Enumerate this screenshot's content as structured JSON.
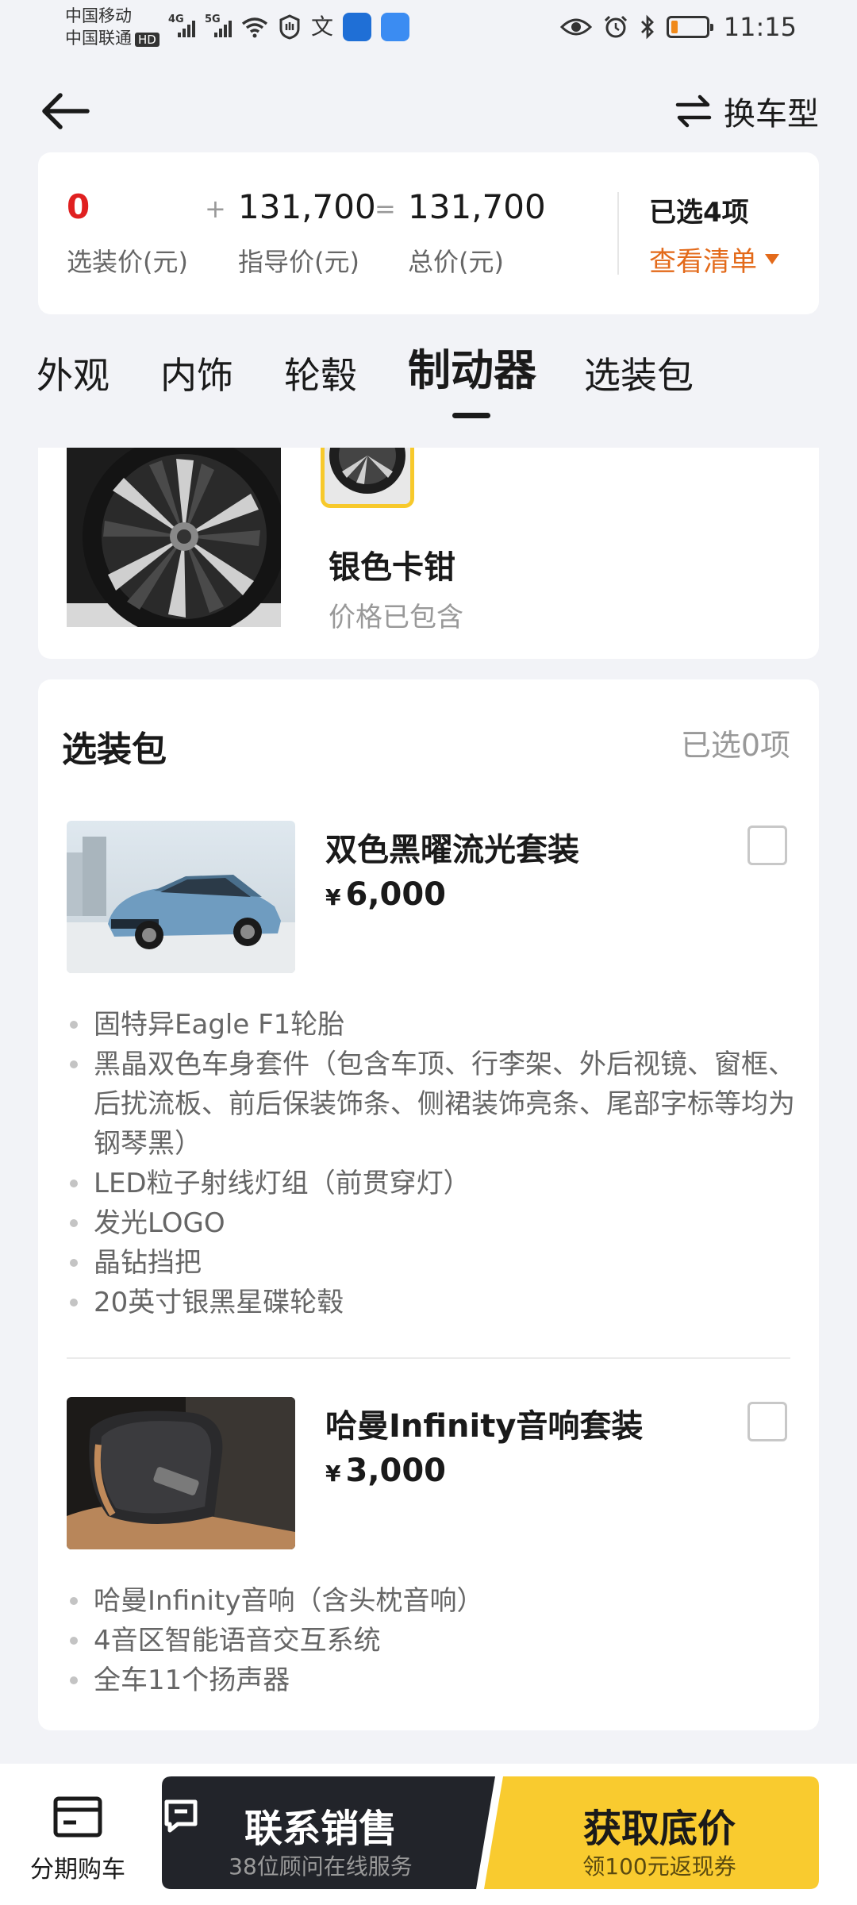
{
  "status_bar": {
    "carrier_1": "中国移动",
    "carrier_2": "中国联通",
    "hd_badge": "HD",
    "net_1": "4G",
    "net_2": "5G",
    "time": "11:15",
    "battery_level": 0.2
  },
  "header": {
    "change_model_label": "换车型"
  },
  "price_summary": {
    "option_price": "0",
    "option_price_label": "选装价(元)",
    "plus": "+",
    "guide_price": "131,700",
    "guide_price_label": "指导价(元)",
    "equals": "=",
    "total_price": "131,700",
    "total_price_label": "总价(元)",
    "selected_count": "已选4项",
    "view_list": "查看清单"
  },
  "tabs": [
    {
      "label": "外观"
    },
    {
      "label": "内饰"
    },
    {
      "label": "轮毂"
    },
    {
      "label": "制动器",
      "active": true
    },
    {
      "label": "选装包"
    }
  ],
  "brake": {
    "name": "银色卡钳",
    "note": "价格已包含"
  },
  "packages": {
    "title": "选装包",
    "selected_count": "已选0项",
    "items": [
      {
        "name": "双色黑曜流光套装",
        "currency": "¥",
        "price": "6,000",
        "features": [
          "固特异Eagle F1轮胎",
          "黑晶双色车身套件（包含车顶、行李架、外后视镜、窗框、后扰流板、前后保装饰条、侧裙装饰亮条、尾部字标等均为钢琴黑）",
          "LED粒子射线灯组（前贯穿灯）",
          "发光LOGO",
          "晶钻挡把",
          "20英寸银黑星碟轮毂"
        ]
      },
      {
        "name": "哈曼Infinity音响套装",
        "currency": "¥",
        "price": "3,000",
        "features": [
          "哈曼Infinity音响（含头枕音响）",
          "4音区智能语音交互系统",
          "全车11个扬声器"
        ]
      }
    ]
  },
  "bottom_bar": {
    "installment_label": "分期购车",
    "contact_main": "联系销售",
    "contact_sub": "38位顾问在线服务",
    "price_main": "获取底价",
    "price_sub": "领100元返现券"
  },
  "colors": {
    "accent_orange": "#E36A1A",
    "price_red": "#E02020",
    "brand_yellow": "#F9CB2F",
    "dark_button": "#22242A"
  }
}
